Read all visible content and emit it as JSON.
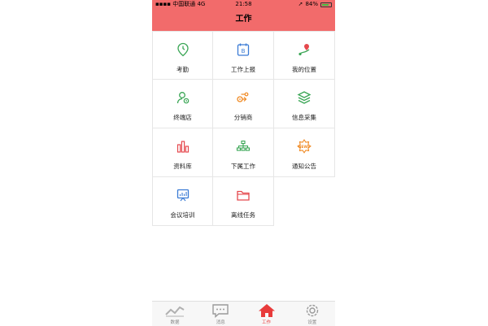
{
  "status_bar": {
    "carrier": "中国联通",
    "network": "4G",
    "time": "21:58",
    "battery": "84%",
    "battery_level": 0.84
  },
  "header": {
    "title": "工作"
  },
  "grid_items": [
    {
      "label": "考勤",
      "icon": "location-clock-icon"
    },
    {
      "label": "工作上报",
      "icon": "calendar-report-icon"
    },
    {
      "label": "我的位置",
      "icon": "map-pin-icon"
    },
    {
      "label": "终端店",
      "icon": "person-store-icon"
    },
    {
      "label": "分销商",
      "icon": "distributor-icon"
    },
    {
      "label": "信息采集",
      "icon": "layers-icon"
    },
    {
      "label": "资料库",
      "icon": "bar-chart-icon"
    },
    {
      "label": "下属工作",
      "icon": "org-chart-icon"
    },
    {
      "label": "通知公告",
      "icon": "news-icon"
    },
    {
      "label": "会议培训",
      "icon": "presentation-icon"
    },
    {
      "label": "离线任务",
      "icon": "folder-icon"
    }
  ],
  "tabbar": [
    {
      "label": "数据",
      "icon": "chart-line-icon",
      "active": false
    },
    {
      "label": "消息",
      "icon": "chat-bubble-icon",
      "active": false
    },
    {
      "label": "工作",
      "icon": "home-icon",
      "active": true
    },
    {
      "label": "设置",
      "icon": "gear-icon",
      "active": false
    }
  ],
  "colors": {
    "header": "#f26b6b",
    "active_tab": "#e83b3b",
    "green": "#3aa655",
    "blue": "#3a7bd5",
    "orange": "#f08a24",
    "red": "#e5484d"
  }
}
